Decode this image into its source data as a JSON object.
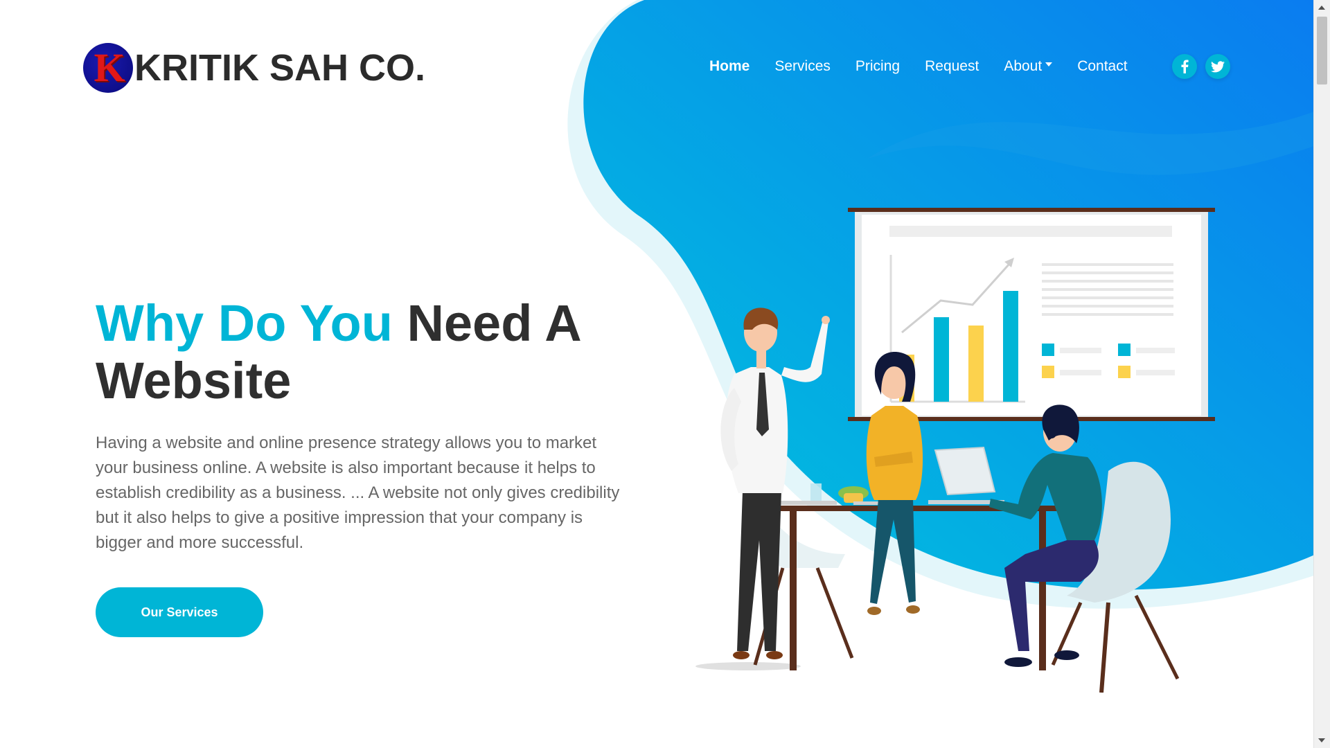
{
  "brand": {
    "logo_letter": "K",
    "name": "KRITIK SAH CO."
  },
  "nav": {
    "items": [
      {
        "label": "Home",
        "active": true
      },
      {
        "label": "Services"
      },
      {
        "label": "Pricing"
      },
      {
        "label": "Request"
      },
      {
        "label": "About",
        "has_dropdown": true
      },
      {
        "label": "Contact"
      }
    ],
    "socials": [
      "facebook-icon",
      "twitter-icon"
    ]
  },
  "hero": {
    "title_accent": "Why Do You",
    "title_rest": " Need A Website",
    "description": "Having a website and online presence strategy allows you to market your business online. A website is also important because it helps to establish credibility as a business. ... A website not only gives credibility but it also helps to give a positive impression that your company is bigger and more successful.",
    "cta_label": "Our Services"
  },
  "colors": {
    "accent": "#00b5d6",
    "gradient_start": "#00c6dc",
    "gradient_end": "#0a7cf0",
    "heading": "#2f2f2f",
    "body_text": "#666666"
  }
}
